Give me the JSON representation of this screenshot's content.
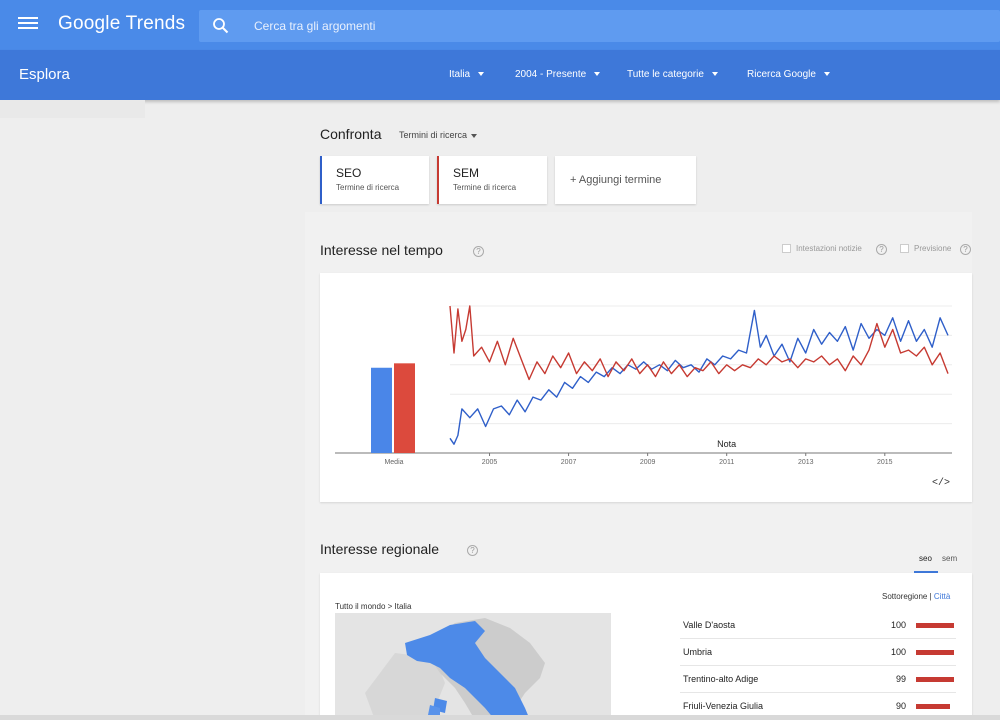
{
  "header": {
    "logo": "Google Trends",
    "search_placeholder": "Cerca tra gli argomenti"
  },
  "explore": {
    "title": "Esplora",
    "filters": [
      "Italia",
      "2004 - Presente",
      "Tutte le categorie",
      "Ricerca Google"
    ]
  },
  "compare": {
    "title": "Confronta",
    "type_label": "Termini di ricerca",
    "terms": [
      {
        "name": "SEO",
        "sub": "Termine di ricerca",
        "color": "#2f5fc9"
      },
      {
        "name": "SEM",
        "sub": "Termine di ricerca",
        "color": "#c63a32"
      }
    ],
    "add_label": "+ Aggiungi termine"
  },
  "interest_time": {
    "title": "Interesse nel tempo",
    "help": "?",
    "options": [
      "Intestazioni notizie",
      "Previsione"
    ],
    "embed": "</>"
  },
  "chart_data": {
    "type": "line",
    "x_range": [
      2004,
      2016.7
    ],
    "ylim": [
      0,
      100
    ],
    "x_tick_labels": [
      "2005",
      "2007",
      "2009",
      "2011",
      "2013",
      "2015"
    ],
    "x_ticks": [
      2005,
      2007,
      2009,
      2011,
      2013,
      2015
    ],
    "average_label": "Media",
    "averages": [
      {
        "name": "SEO",
        "value": 58
      },
      {
        "name": "SEM",
        "value": 61
      }
    ],
    "annotation": {
      "text": "Nota",
      "x": 2011
    },
    "grid": true,
    "series": [
      {
        "name": "SEO",
        "color": "#2f5fc9",
        "points": [
          [
            2004.0,
            10
          ],
          [
            2004.1,
            6
          ],
          [
            2004.2,
            12
          ],
          [
            2004.3,
            30
          ],
          [
            2004.5,
            24
          ],
          [
            2004.7,
            30
          ],
          [
            2004.9,
            18
          ],
          [
            2005.1,
            30
          ],
          [
            2005.3,
            32
          ],
          [
            2005.5,
            26
          ],
          [
            2005.7,
            36
          ],
          [
            2005.9,
            28
          ],
          [
            2006.1,
            38
          ],
          [
            2006.3,
            36
          ],
          [
            2006.5,
            43
          ],
          [
            2006.7,
            38
          ],
          [
            2006.9,
            48
          ],
          [
            2007.1,
            44
          ],
          [
            2007.3,
            52
          ],
          [
            2007.5,
            48
          ],
          [
            2007.7,
            55
          ],
          [
            2007.9,
            52
          ],
          [
            2008.1,
            58
          ],
          [
            2008.3,
            54
          ],
          [
            2008.5,
            60
          ],
          [
            2008.7,
            57
          ],
          [
            2008.9,
            62
          ],
          [
            2009.1,
            57
          ],
          [
            2009.3,
            60
          ],
          [
            2009.5,
            56
          ],
          [
            2009.7,
            63
          ],
          [
            2009.9,
            58
          ],
          [
            2010.1,
            60
          ],
          [
            2010.3,
            55
          ],
          [
            2010.5,
            64
          ],
          [
            2010.7,
            60
          ],
          [
            2010.9,
            66
          ],
          [
            2011.1,
            64
          ],
          [
            2011.3,
            70
          ],
          [
            2011.5,
            68
          ],
          [
            2011.7,
            97
          ],
          [
            2011.85,
            72
          ],
          [
            2012.0,
            80
          ],
          [
            2012.2,
            66
          ],
          [
            2012.4,
            74
          ],
          [
            2012.6,
            62
          ],
          [
            2012.8,
            78
          ],
          [
            2013.0,
            68
          ],
          [
            2013.2,
            84
          ],
          [
            2013.4,
            74
          ],
          [
            2013.6,
            82
          ],
          [
            2013.8,
            76
          ],
          [
            2014.0,
            86
          ],
          [
            2014.2,
            70
          ],
          [
            2014.4,
            88
          ],
          [
            2014.6,
            78
          ],
          [
            2014.8,
            84
          ],
          [
            2015.0,
            80
          ],
          [
            2015.2,
            92
          ],
          [
            2015.4,
            76
          ],
          [
            2015.6,
            90
          ],
          [
            2015.8,
            76
          ],
          [
            2016.0,
            84
          ],
          [
            2016.2,
            72
          ],
          [
            2016.4,
            92
          ],
          [
            2016.6,
            80
          ]
        ]
      },
      {
        "name": "SEM",
        "color": "#c63a32",
        "points": [
          [
            2004.0,
            100
          ],
          [
            2004.1,
            68
          ],
          [
            2004.2,
            98
          ],
          [
            2004.3,
            76
          ],
          [
            2004.4,
            84
          ],
          [
            2004.5,
            100
          ],
          [
            2004.6,
            66
          ],
          [
            2004.8,
            72
          ],
          [
            2005.0,
            62
          ],
          [
            2005.2,
            76
          ],
          [
            2005.4,
            60
          ],
          [
            2005.6,
            78
          ],
          [
            2005.8,
            64
          ],
          [
            2006.0,
            50
          ],
          [
            2006.2,
            62
          ],
          [
            2006.4,
            54
          ],
          [
            2006.6,
            66
          ],
          [
            2006.8,
            58
          ],
          [
            2007.0,
            68
          ],
          [
            2007.2,
            54
          ],
          [
            2007.4,
            62
          ],
          [
            2007.6,
            56
          ],
          [
            2007.8,
            64
          ],
          [
            2008.0,
            52
          ],
          [
            2008.2,
            62
          ],
          [
            2008.4,
            56
          ],
          [
            2008.6,
            64
          ],
          [
            2008.8,
            54
          ],
          [
            2009.0,
            60
          ],
          [
            2009.2,
            52
          ],
          [
            2009.4,
            62
          ],
          [
            2009.6,
            54
          ],
          [
            2009.8,
            60
          ],
          [
            2010.0,
            52
          ],
          [
            2010.2,
            58
          ],
          [
            2010.4,
            56
          ],
          [
            2010.6,
            62
          ],
          [
            2010.8,
            54
          ],
          [
            2011.0,
            60
          ],
          [
            2011.2,
            56
          ],
          [
            2011.4,
            60
          ],
          [
            2011.6,
            58
          ],
          [
            2011.8,
            64
          ],
          [
            2012.0,
            60
          ],
          [
            2012.2,
            66
          ],
          [
            2012.4,
            62
          ],
          [
            2012.6,
            64
          ],
          [
            2012.8,
            58
          ],
          [
            2013.0,
            64
          ],
          [
            2013.2,
            62
          ],
          [
            2013.4,
            66
          ],
          [
            2013.6,
            60
          ],
          [
            2013.8,
            64
          ],
          [
            2014.0,
            56
          ],
          [
            2014.2,
            66
          ],
          [
            2014.4,
            60
          ],
          [
            2014.6,
            70
          ],
          [
            2014.8,
            88
          ],
          [
            2015.0,
            72
          ],
          [
            2015.2,
            84
          ],
          [
            2015.4,
            68
          ],
          [
            2015.6,
            70
          ],
          [
            2015.8,
            66
          ],
          [
            2016.0,
            72
          ],
          [
            2016.2,
            60
          ],
          [
            2016.4,
            68
          ],
          [
            2016.6,
            54
          ]
        ]
      }
    ]
  },
  "regional": {
    "title": "Interesse regionale",
    "help": "?",
    "tabs": [
      "seo",
      "sem"
    ],
    "breadcrumb": "Tutto il mondo > Italia",
    "resolution": {
      "subregion": "Sottoregione",
      "separator": " | ",
      "city": "Città"
    },
    "rows": [
      {
        "name": "Valle D'aosta",
        "value": 100
      },
      {
        "name": "Umbria",
        "value": 100
      },
      {
        "name": "Trentino-alto Adige",
        "value": 99
      },
      {
        "name": "Friuli-Venezia Giulia",
        "value": 90
      }
    ]
  }
}
